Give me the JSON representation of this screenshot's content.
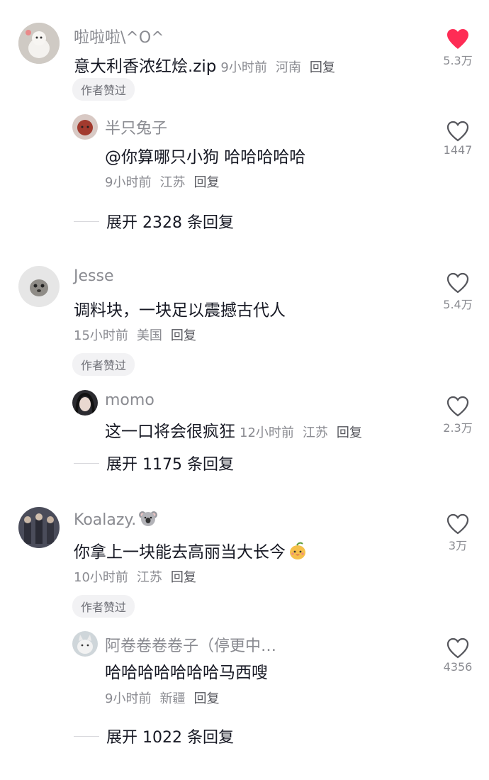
{
  "comments": [
    {
      "username": "啦啦啦\\^O^",
      "text": "意大利香浓红烩.zip",
      "time": "9小时前",
      "location": "河南",
      "reply_label": "回复",
      "badge": "作者赞过",
      "likes": "5.3万",
      "liked": true,
      "reply": {
        "username": "半只兔子",
        "text": "@你算哪只小狗  哈哈哈哈哈",
        "time": "9小时前",
        "location": "江苏",
        "reply_label": "回复",
        "likes": "1447"
      },
      "expand_label": "展开 2328 条回复"
    },
    {
      "username": "Jesse",
      "text": "调料块，一块足以震撼古代人",
      "time": "15小时前",
      "location": "美国",
      "reply_label": "回复",
      "badge": "作者赞过",
      "likes": "5.4万",
      "liked": false,
      "reply": {
        "username": "momo",
        "text": "这一口将会很疯狂",
        "time": "12小时前",
        "location": "江苏",
        "reply_label": "回复",
        "likes": "2.3万"
      },
      "expand_label": "展开 1175 条回复"
    },
    {
      "username": "Koalazy.",
      "username_emoji": "koala-emoji",
      "text": "你拿上一块能去高丽当大长今",
      "text_emoji": "mango-face-emoji",
      "time": "10小时前",
      "location": "江苏",
      "reply_label": "回复",
      "badge": "作者赞过",
      "likes": "3万",
      "liked": false,
      "reply": {
        "username": "阿卷卷卷卷子（停更中…",
        "text": "哈哈哈哈哈哈哈马西嗖",
        "time": "9小时前",
        "location": "新疆",
        "reply_label": "回复",
        "likes": "4356"
      },
      "expand_label": "展开 1022 条回复"
    }
  ],
  "colors": {
    "like_active": "#fe2c55",
    "text_primary": "#161823",
    "text_secondary": "#8a8b91",
    "badge_bg": "#f2f2f4"
  }
}
